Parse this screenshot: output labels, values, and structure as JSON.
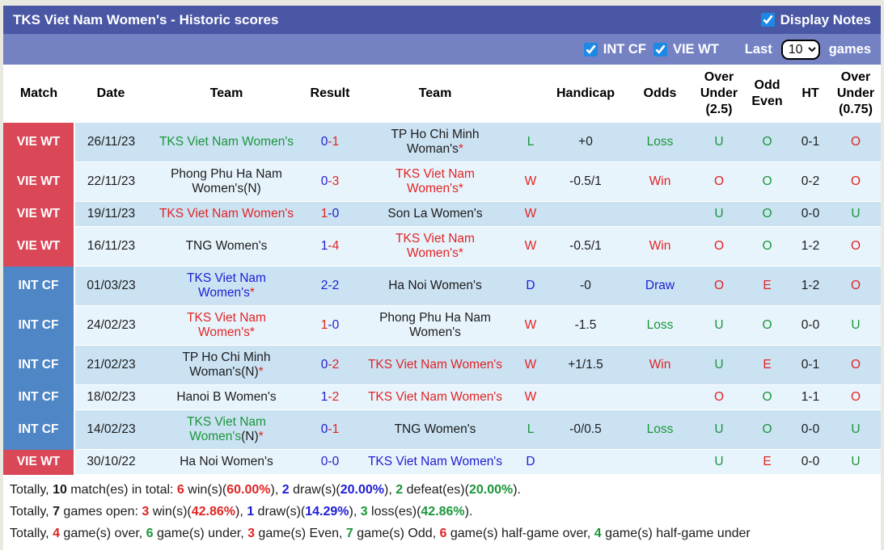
{
  "colors": {
    "red": "#e02424",
    "green": "#1a9639",
    "blue": "#1d1dd4",
    "black": "#1c1c1c",
    "star": "#e02424",
    "vie_bg": "#da4757",
    "int_bg": "#4f86c6",
    "header_bar": "#4a57a5",
    "filter_bar": "#7482c4",
    "row_odd": "#cbe2f3",
    "row_even": "#e8f4fc",
    "page_bg": "#e9e9e1",
    "accent": "#1e88e5"
  },
  "titlebar": {
    "title": "TKS Viet Nam Women's - Historic scores",
    "display_notes_label": "Display Notes",
    "display_notes_checked": true
  },
  "filterbar": {
    "int_cf_label": "INT CF",
    "int_cf_checked": true,
    "vie_wt_label": "VIE WT",
    "vie_wt_checked": true,
    "last_label": "Last",
    "selected_games": "10",
    "games_label": "games"
  },
  "table": {
    "headers": [
      "Match",
      "Date",
      "Team",
      "Result",
      "Team",
      "",
      "Handicap",
      "Odds",
      "Over Under (2.5)",
      "Odd Even",
      "HT",
      "Over Under (0.75)"
    ],
    "rows": [
      {
        "league": "VIE WT",
        "league_type": "vie",
        "date": "26/11/23",
        "home": {
          "lines": [
            "TKS Viet Nam Women's"
          ],
          "suffix": "",
          "star": false,
          "color": "green"
        },
        "result": {
          "home": "0",
          "away": "1",
          "home_color": "blue",
          "away_color": "red"
        },
        "away": {
          "lines": [
            "TP Ho Chi Minh",
            "Woman's"
          ],
          "suffix": "",
          "star": true,
          "color": "black"
        },
        "wdl": {
          "text": "L",
          "color": "green"
        },
        "handicap": "+0",
        "odds": {
          "text": "Loss",
          "color": "green"
        },
        "ou25": {
          "text": "U",
          "color": "green"
        },
        "odd_even": {
          "text": "O",
          "color": "green"
        },
        "ht": "0-1",
        "ou075": {
          "text": "O",
          "color": "red"
        }
      },
      {
        "league": "VIE WT",
        "league_type": "vie",
        "date": "22/11/23",
        "home": {
          "lines": [
            "Phong Phu Ha Nam",
            "Women's"
          ],
          "suffix": "(N)",
          "star": false,
          "color": "black"
        },
        "result": {
          "home": "0",
          "away": "3",
          "home_color": "blue",
          "away_color": "red"
        },
        "away": {
          "lines": [
            "TKS Viet Nam",
            "Women's"
          ],
          "suffix": "",
          "star": true,
          "color": "red"
        },
        "wdl": {
          "text": "W",
          "color": "red"
        },
        "handicap": "-0.5/1",
        "odds": {
          "text": "Win",
          "color": "red"
        },
        "ou25": {
          "text": "O",
          "color": "red"
        },
        "odd_even": {
          "text": "O",
          "color": "green"
        },
        "ht": "0-2",
        "ou075": {
          "text": "O",
          "color": "red"
        }
      },
      {
        "league": "VIE WT",
        "league_type": "vie",
        "date": "19/11/23",
        "home": {
          "lines": [
            "TKS Viet Nam Women's"
          ],
          "suffix": "",
          "star": false,
          "color": "red"
        },
        "result": {
          "home": "1",
          "away": "0",
          "home_color": "red",
          "away_color": "blue"
        },
        "away": {
          "lines": [
            "Son La Women's"
          ],
          "suffix": "",
          "star": false,
          "color": "black"
        },
        "wdl": {
          "text": "W",
          "color": "red"
        },
        "handicap": "",
        "odds": {
          "text": "",
          "color": "black"
        },
        "ou25": {
          "text": "U",
          "color": "green"
        },
        "odd_even": {
          "text": "O",
          "color": "green"
        },
        "ht": "0-0",
        "ou075": {
          "text": "U",
          "color": "green"
        }
      },
      {
        "league": "VIE WT",
        "league_type": "vie",
        "date": "16/11/23",
        "home": {
          "lines": [
            "TNG Women's"
          ],
          "suffix": "",
          "star": false,
          "color": "black"
        },
        "result": {
          "home": "1",
          "away": "4",
          "home_color": "blue",
          "away_color": "red"
        },
        "away": {
          "lines": [
            "TKS Viet Nam",
            "Women's"
          ],
          "suffix": "",
          "star": true,
          "color": "red"
        },
        "wdl": {
          "text": "W",
          "color": "red"
        },
        "handicap": "-0.5/1",
        "odds": {
          "text": "Win",
          "color": "red"
        },
        "ou25": {
          "text": "O",
          "color": "red"
        },
        "odd_even": {
          "text": "O",
          "color": "green"
        },
        "ht": "1-2",
        "ou075": {
          "text": "O",
          "color": "red"
        }
      },
      {
        "league": "INT CF",
        "league_type": "int",
        "date": "01/03/23",
        "home": {
          "lines": [
            "TKS Viet Nam",
            "Women's"
          ],
          "suffix": "",
          "star": true,
          "color": "blue"
        },
        "result": {
          "home": "2",
          "away": "2",
          "home_color": "blue",
          "away_color": "blue"
        },
        "away": {
          "lines": [
            "Ha Noi Women's"
          ],
          "suffix": "",
          "star": false,
          "color": "black"
        },
        "wdl": {
          "text": "D",
          "color": "blue"
        },
        "handicap": "-0",
        "odds": {
          "text": "Draw",
          "color": "blue"
        },
        "ou25": {
          "text": "O",
          "color": "red"
        },
        "odd_even": {
          "text": "E",
          "color": "red"
        },
        "ht": "1-2",
        "ou075": {
          "text": "O",
          "color": "red"
        }
      },
      {
        "league": "INT CF",
        "league_type": "int",
        "date": "24/02/23",
        "home": {
          "lines": [
            "TKS Viet Nam",
            "Women's"
          ],
          "suffix": "",
          "star": true,
          "color": "red"
        },
        "result": {
          "home": "1",
          "away": "0",
          "home_color": "red",
          "away_color": "blue"
        },
        "away": {
          "lines": [
            "Phong Phu Ha Nam",
            "Women's"
          ],
          "suffix": "",
          "star": false,
          "color": "black"
        },
        "wdl": {
          "text": "W",
          "color": "red"
        },
        "handicap": "-1.5",
        "odds": {
          "text": "Loss",
          "color": "green"
        },
        "ou25": {
          "text": "U",
          "color": "green"
        },
        "odd_even": {
          "text": "O",
          "color": "green"
        },
        "ht": "0-0",
        "ou075": {
          "text": "U",
          "color": "green"
        }
      },
      {
        "league": "INT CF",
        "league_type": "int",
        "date": "21/02/23",
        "home": {
          "lines": [
            "TP Ho Chi Minh",
            "Woman's"
          ],
          "suffix": "(N)",
          "star": true,
          "color": "black"
        },
        "result": {
          "home": "0",
          "away": "2",
          "home_color": "blue",
          "away_color": "red"
        },
        "away": {
          "lines": [
            "TKS Viet Nam Women's"
          ],
          "suffix": "",
          "star": false,
          "color": "red"
        },
        "wdl": {
          "text": "W",
          "color": "red"
        },
        "handicap": "+1/1.5",
        "odds": {
          "text": "Win",
          "color": "red"
        },
        "ou25": {
          "text": "U",
          "color": "green"
        },
        "odd_even": {
          "text": "E",
          "color": "red"
        },
        "ht": "0-1",
        "ou075": {
          "text": "O",
          "color": "red"
        }
      },
      {
        "league": "INT CF",
        "league_type": "int",
        "date": "18/02/23",
        "home": {
          "lines": [
            "Hanoi B Women's"
          ],
          "suffix": "",
          "star": false,
          "color": "black"
        },
        "result": {
          "home": "1",
          "away": "2",
          "home_color": "blue",
          "away_color": "red"
        },
        "away": {
          "lines": [
            "TKS Viet Nam Women's"
          ],
          "suffix": "",
          "star": false,
          "color": "red"
        },
        "wdl": {
          "text": "W",
          "color": "red"
        },
        "handicap": "",
        "odds": {
          "text": "",
          "color": "black"
        },
        "ou25": {
          "text": "O",
          "color": "red"
        },
        "odd_even": {
          "text": "O",
          "color": "green"
        },
        "ht": "1-1",
        "ou075": {
          "text": "O",
          "color": "red"
        }
      },
      {
        "league": "INT CF",
        "league_type": "int",
        "date": "14/02/23",
        "home": {
          "lines": [
            "TKS Viet Nam",
            "Women's"
          ],
          "suffix": "(N)",
          "star": true,
          "color": "green"
        },
        "result": {
          "home": "0",
          "away": "1",
          "home_color": "blue",
          "away_color": "red"
        },
        "away": {
          "lines": [
            "TNG Women's"
          ],
          "suffix": "",
          "star": false,
          "color": "black"
        },
        "wdl": {
          "text": "L",
          "color": "green"
        },
        "handicap": "-0/0.5",
        "odds": {
          "text": "Loss",
          "color": "green"
        },
        "ou25": {
          "text": "U",
          "color": "green"
        },
        "odd_even": {
          "text": "O",
          "color": "green"
        },
        "ht": "0-0",
        "ou075": {
          "text": "U",
          "color": "green"
        }
      },
      {
        "league": "VIE WT",
        "league_type": "vie",
        "date": "30/10/22",
        "home": {
          "lines": [
            "Ha Noi Women's"
          ],
          "suffix": "",
          "star": false,
          "color": "black"
        },
        "result": {
          "home": "0",
          "away": "0",
          "home_color": "blue",
          "away_color": "blue"
        },
        "away": {
          "lines": [
            "TKS Viet Nam Women's"
          ],
          "suffix": "",
          "star": false,
          "color": "blue"
        },
        "wdl": {
          "text": "D",
          "color": "blue"
        },
        "handicap": "",
        "odds": {
          "text": "",
          "color": "black"
        },
        "ou25": {
          "text": "U",
          "color": "green"
        },
        "odd_even": {
          "text": "E",
          "color": "red"
        },
        "ht": "0-0",
        "ou075": {
          "text": "U",
          "color": "green"
        }
      }
    ]
  },
  "summary": {
    "lines": [
      [
        {
          "t": "Totally, "
        },
        {
          "t": "10",
          "b": 1
        },
        {
          "t": " match(es) in total: "
        },
        {
          "t": "6",
          "c": "red",
          "b": 1
        },
        {
          "t": " win(s)("
        },
        {
          "t": "60.00%",
          "c": "red",
          "b": 1
        },
        {
          "t": "), "
        },
        {
          "t": "2",
          "c": "blue",
          "b": 1
        },
        {
          "t": " draw(s)("
        },
        {
          "t": "20.00%",
          "c": "blue",
          "b": 1
        },
        {
          "t": "), "
        },
        {
          "t": "2",
          "c": "green",
          "b": 1
        },
        {
          "t": " defeat(es)("
        },
        {
          "t": "20.00%",
          "c": "green",
          "b": 1
        },
        {
          "t": ")."
        }
      ],
      [
        {
          "t": "Totally, "
        },
        {
          "t": "7",
          "b": 1
        },
        {
          "t": " games open: "
        },
        {
          "t": "3",
          "c": "red",
          "b": 1
        },
        {
          "t": " win(s)("
        },
        {
          "t": "42.86%",
          "c": "red",
          "b": 1
        },
        {
          "t": "), "
        },
        {
          "t": "1",
          "c": "blue",
          "b": 1
        },
        {
          "t": " draw(s)("
        },
        {
          "t": "14.29%",
          "c": "blue",
          "b": 1
        },
        {
          "t": "), "
        },
        {
          "t": "3",
          "c": "green",
          "b": 1
        },
        {
          "t": " loss(es)("
        },
        {
          "t": "42.86%",
          "c": "green",
          "b": 1
        },
        {
          "t": ")."
        }
      ],
      [
        {
          "t": "Totally, "
        },
        {
          "t": "4",
          "c": "red",
          "b": 1
        },
        {
          "t": " game(s) over, "
        },
        {
          "t": "6",
          "c": "green",
          "b": 1
        },
        {
          "t": " game(s) under, "
        },
        {
          "t": "3",
          "c": "red",
          "b": 1
        },
        {
          "t": " game(s) Even, "
        },
        {
          "t": "7",
          "c": "green",
          "b": 1
        },
        {
          "t": " game(s) Odd, "
        },
        {
          "t": "6",
          "c": "red",
          "b": 1
        },
        {
          "t": " game(s) half-game over, "
        },
        {
          "t": "4",
          "c": "green",
          "b": 1
        },
        {
          "t": " game(s) half-game under"
        }
      ]
    ]
  }
}
